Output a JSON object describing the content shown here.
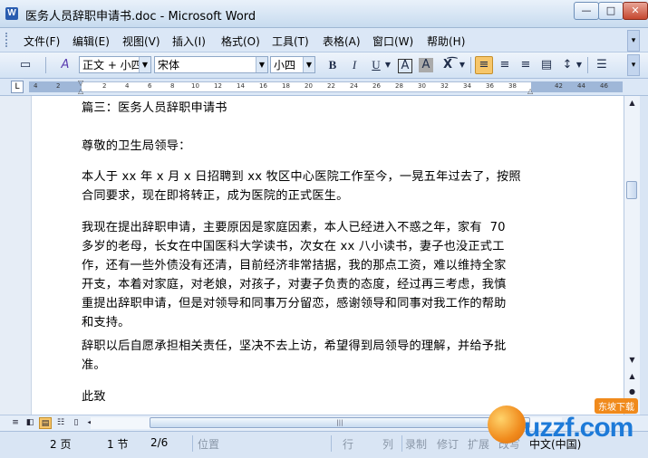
{
  "window": {
    "title": "医务人员辞职申请书.doc - Microsoft Word",
    "app_icon_letter": "W",
    "minimize": "—",
    "maximize": "□",
    "close": "✕"
  },
  "menu": {
    "items": [
      "文件(F)",
      "编辑(E)",
      "视图(V)",
      "插入(I)",
      "格式(O)",
      "工具(T)",
      "表格(A)",
      "窗口(W)",
      "帮助(H)"
    ]
  },
  "toolbar": {
    "style_value": "正文 + 小四",
    "font_value": "宋体",
    "size_value": "小四",
    "bold": "B",
    "italic": "I",
    "underline": "U",
    "char_border": "A",
    "char_shade": "A"
  },
  "ruler": {
    "tab_selector": "L",
    "ticks": [
      "4",
      "2",
      "2",
      "4",
      "6",
      "8",
      "10",
      "12",
      "14",
      "16",
      "18",
      "20",
      "22",
      "24",
      "26",
      "28",
      "30",
      "32",
      "34",
      "36",
      "38",
      "42",
      "44",
      "46"
    ]
  },
  "document": {
    "lines": [
      "篇三：医务人员辞职申请书",
      "",
      "尊敬的卫生局领导：",
      "",
      "本人于 xx 年 x 月 x 日招聘到 xx 牧区中心医院工作至今，一晃五年过去了，按照",
      "合同要求，现在即将转正，成为医院的正式医生。",
      "",
      "我现在提出辞职申请，主要原因是家庭因素，本人已经进入不惑之年，家有  70",
      "多岁的老母，长女在中国医科大学读书，次女在 xx 八小读书，妻子也没正式工",
      "作，还有一些外债没有还清，目前经济非常拮据，我的那点工资，难以维持全家",
      "开支，本着对家庭，对老娘，对孩子，对妻子负责的态度，经过再三考虑，我慎",
      "重提出辞职申请，但是对领导和同事万分留恋，感谢领导和同事对我工作的帮助",
      "和支持。",
      "",
      "辞职以后自愿承担相关责任，坚决不去上访，希望得到局领导的理解，并给予批",
      "准。",
      "",
      "此致"
    ]
  },
  "status": {
    "page": "2 页",
    "section": "1 节",
    "page_of": "2/6",
    "position": "位置",
    "line": "行",
    "column": "列",
    "record": "录制",
    "revise": "修订",
    "extend": "扩展",
    "overwrite": "改写",
    "language": "中文(中国)"
  },
  "watermark": {
    "text": "uzzf.com",
    "badge": "东坡下载"
  },
  "colors": {
    "accent": "#f7c66a",
    "chrome": "#dbe7f6",
    "watermark_blue": "#1d7ad8",
    "watermark_orange": "#f08a1c"
  }
}
